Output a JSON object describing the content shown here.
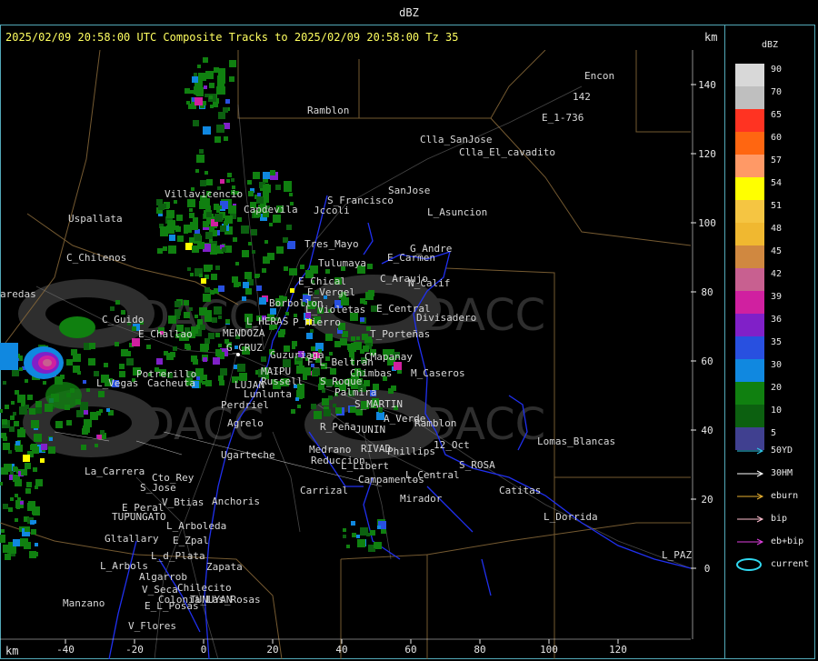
{
  "window": {
    "title": "dBZ"
  },
  "header": {
    "text": "2025/02/09 20:58:00 UTC Composite Tracks to 2025/02/09 20:58:00 Tz 35",
    "km_unit": "km"
  },
  "axes": {
    "y_ticks": [
      "140",
      "120",
      "100",
      "80",
      "60",
      "40",
      "20",
      "0"
    ],
    "x_ticks": [
      "-40",
      "-20",
      "0",
      "20",
      "40",
      "60",
      "80",
      "100",
      "120"
    ],
    "x_unit": "km"
  },
  "legend": {
    "title": "dBZ",
    "bins": [
      {
        "label": "90",
        "color": "#d8d8d8"
      },
      {
        "label": "70",
        "color": "#bfbfbf"
      },
      {
        "label": "65",
        "color": "#ff3322"
      },
      {
        "label": "60",
        "color": "#ff6611"
      },
      {
        "label": "57",
        "color": "#ff9966"
      },
      {
        "label": "54",
        "color": "#ffff00"
      },
      {
        "label": "51",
        "color": "#f5c542"
      },
      {
        "label": "48",
        "color": "#f0b830"
      },
      {
        "label": "45",
        "color": "#d08840"
      },
      {
        "label": "42",
        "color": "#c86090"
      },
      {
        "label": "39",
        "color": "#d020a0"
      },
      {
        "label": "36",
        "color": "#8020c8"
      },
      {
        "label": "35",
        "color": "#2850e0"
      },
      {
        "label": "30",
        "color": "#1088e0"
      },
      {
        "label": "20",
        "color": "#108010"
      },
      {
        "label": "10",
        "color": "#0c6010"
      },
      {
        "label": "5",
        "color": "#404090"
      }
    ],
    "tracks": [
      {
        "label": "50YD",
        "color": "#30c8e8"
      },
      {
        "label": "30HM",
        "color": "#ffffff"
      },
      {
        "label": "eburn",
        "color": "#e8b030"
      },
      {
        "label": "bip",
        "color": "#ffc0d0"
      },
      {
        "label": "eb+bip",
        "color": "#e040e0"
      },
      {
        "label": "current",
        "color": "#30d8f0"
      }
    ]
  },
  "places": [
    {
      "name": "Ramblon"
    },
    {
      "name": "Encon"
    },
    {
      "name": "E_1-736"
    },
    {
      "name": "142"
    },
    {
      "name": "Clla_SanJose"
    },
    {
      "name": "Clla_El_cavadito"
    },
    {
      "name": "Villavicencio"
    },
    {
      "name": "SanJose"
    },
    {
      "name": "S_Francisco"
    },
    {
      "name": "Jccoli"
    },
    {
      "name": "Uspallata"
    },
    {
      "name": "Capdevila"
    },
    {
      "name": "L_Asuncion"
    },
    {
      "name": "Tres_Mayo"
    },
    {
      "name": "G_Andre"
    },
    {
      "name": "Tulumaya"
    },
    {
      "name": "E_Carmen"
    },
    {
      "name": "C_Chilenos"
    },
    {
      "name": "E_Chical"
    },
    {
      "name": "C_Araujo"
    },
    {
      "name": "N_Calif"
    },
    {
      "name": "E_Vergel"
    },
    {
      "name": "Borbollon"
    },
    {
      "name": "aredas"
    },
    {
      "name": "L_Violetas"
    },
    {
      "name": "E_Central"
    },
    {
      "name": "Divisadero"
    },
    {
      "name": "C_Guido"
    },
    {
      "name": "L_HERAS"
    },
    {
      "name": "P_Hierro"
    },
    {
      "name": "E_Challao"
    },
    {
      "name": "MENDOZA"
    },
    {
      "name": "T_Porteñas"
    },
    {
      "name": "G_CRUZ"
    },
    {
      "name": "Guzuriaga"
    },
    {
      "name": "CMapanay"
    },
    {
      "name": "F_L_Beltran"
    },
    {
      "name": "Potrerillo"
    },
    {
      "name": "MAIPU"
    },
    {
      "name": "Chimbas"
    },
    {
      "name": "M_Caseros"
    },
    {
      "name": "L_Vegas"
    },
    {
      "name": "Cacheuta"
    },
    {
      "name": "Russell"
    },
    {
      "name": "S_Roque"
    },
    {
      "name": "LUJAN"
    },
    {
      "name": "Palmira"
    },
    {
      "name": "Lunlunta"
    },
    {
      "name": "Perdriel"
    },
    {
      "name": "S_MARTIN"
    },
    {
      "name": "A_Verde"
    },
    {
      "name": "Agrelo"
    },
    {
      "name": "R_Peña"
    },
    {
      "name": "JUNIN"
    },
    {
      "name": "Ramblon"
    },
    {
      "name": "Lomas_Blancas"
    },
    {
      "name": "12_Oct"
    },
    {
      "name": "Medrano"
    },
    {
      "name": "RIVAD"
    },
    {
      "name": "Phillips"
    },
    {
      "name": "Ugarteche"
    },
    {
      "name": "Reduccion"
    },
    {
      "name": "L_Libert"
    },
    {
      "name": "S_ROSA"
    },
    {
      "name": "L_Central"
    },
    {
      "name": "La_Carrera"
    },
    {
      "name": "Cto_Rey"
    },
    {
      "name": "Campamentos"
    },
    {
      "name": "S_Jose"
    },
    {
      "name": "Carrizal"
    },
    {
      "name": "Catitas"
    },
    {
      "name": "Mirador"
    },
    {
      "name": "E_Peral"
    },
    {
      "name": "V_Btias"
    },
    {
      "name": "Anchoris"
    },
    {
      "name": "TUPUNGATO"
    },
    {
      "name": "L_Dorrida"
    },
    {
      "name": "L_Arboleda"
    },
    {
      "name": "Gltallary"
    },
    {
      "name": "E_Zpal"
    },
    {
      "name": "L_d_Plata"
    },
    {
      "name": "L_PAZ"
    },
    {
      "name": "L_Arbols"
    },
    {
      "name": "Zapata"
    },
    {
      "name": "Algarrob"
    },
    {
      "name": "Chilecito"
    },
    {
      "name": "V_Seca"
    },
    {
      "name": "Manzano"
    },
    {
      "name": "TUNUYAN"
    },
    {
      "name": "E_L_Posas"
    },
    {
      "name": "V_Flores"
    },
    {
      "name": "Colonia_Las_Rosas"
    }
  ]
}
